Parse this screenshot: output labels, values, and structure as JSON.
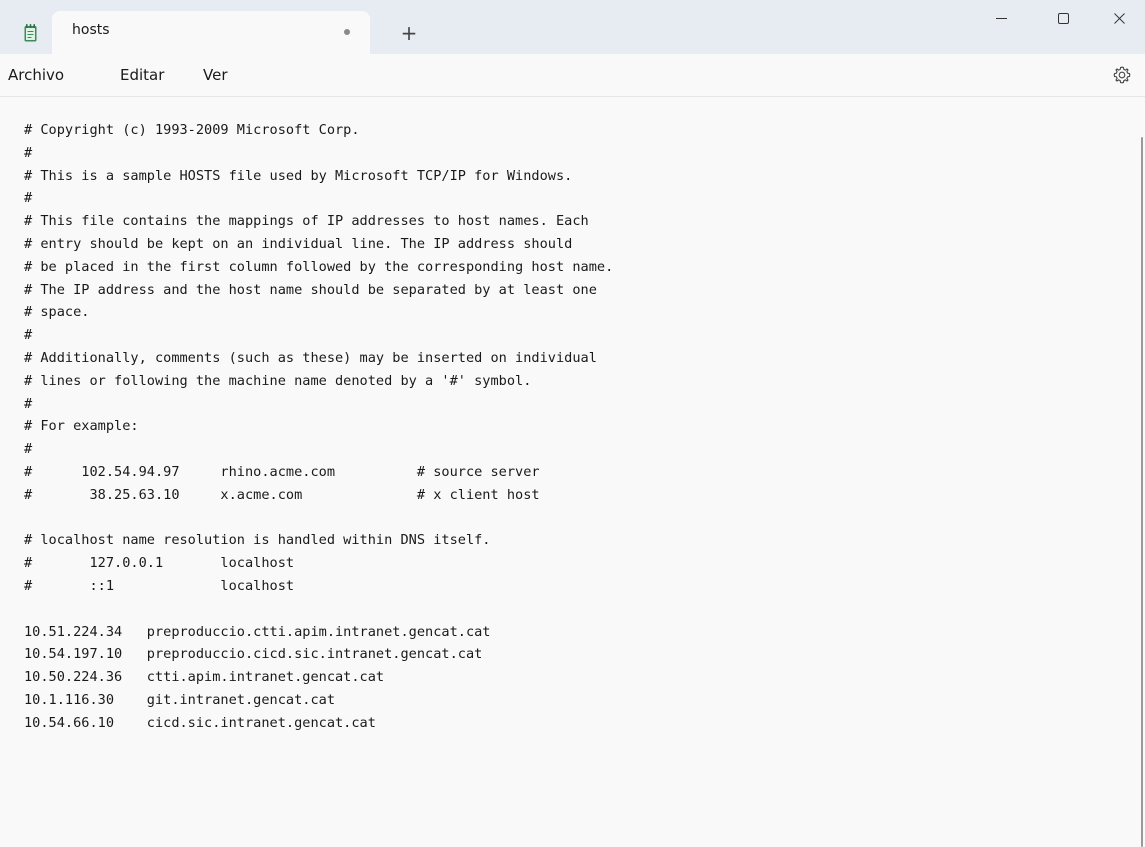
{
  "tab": {
    "title": "hosts",
    "new_tab": "+"
  },
  "menu": {
    "file": "Archivo",
    "edit": "Editar",
    "view": "Ver"
  },
  "icons": {
    "app": "notepad-icon",
    "unsaved": "unsaved-dot-icon",
    "minimize": "minimize-icon",
    "maximize": "maximize-icon",
    "close": "close-icon",
    "settings": "gear-icon"
  },
  "colors": {
    "titlebar": "#e7ecf3",
    "background": "#f9f9f9",
    "text": "#1a1a1a",
    "app_icon": "#3b8c5a"
  },
  "editor": {
    "lines": [
      "# Copyright (c) 1993-2009 Microsoft Corp.",
      "#",
      "# This is a sample HOSTS file used by Microsoft TCP/IP for Windows.",
      "#",
      "# This file contains the mappings of IP addresses to host names. Each",
      "# entry should be kept on an individual line. The IP address should",
      "# be placed in the first column followed by the corresponding host name.",
      "# The IP address and the host name should be separated by at least one",
      "# space.",
      "#",
      "# Additionally, comments (such as these) may be inserted on individual",
      "# lines or following the machine name denoted by a '#' symbol.",
      "#",
      "# For example:",
      "#",
      "#      102.54.94.97     rhino.acme.com          # source server",
      "#       38.25.63.10     x.acme.com              # x client host",
      "",
      "# localhost name resolution is handled within DNS itself.",
      "#       127.0.0.1       localhost",
      "#       ::1             localhost",
      "",
      "10.51.224.34   preproduccio.ctti.apim.intranet.gencat.cat",
      "10.54.197.10   preproduccio.cicd.sic.intranet.gencat.cat",
      "10.50.224.36   ctti.apim.intranet.gencat.cat",
      "10.1.116.30    git.intranet.gencat.cat",
      "10.54.66.10    cicd.sic.intranet.gencat.cat"
    ]
  }
}
